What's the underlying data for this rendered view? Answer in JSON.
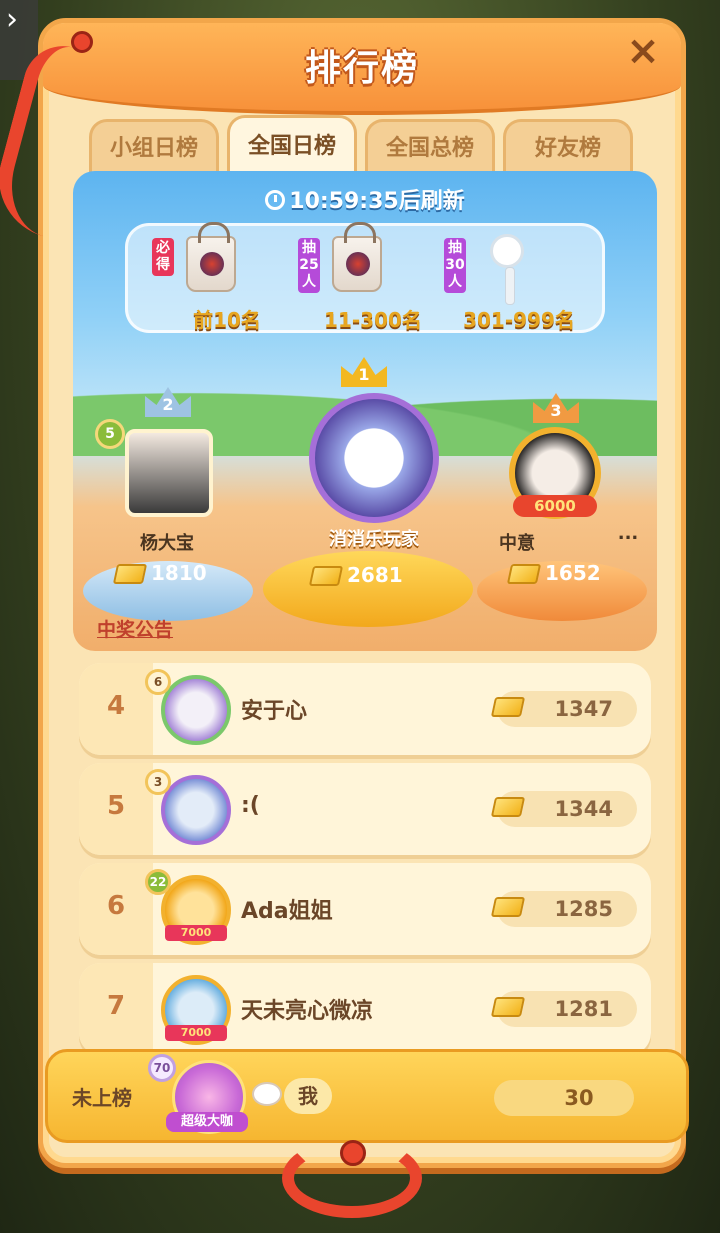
{
  "header": {
    "title": "排行榜",
    "close_icon": "×"
  },
  "back_icon": "›",
  "tabs": [
    {
      "label": "小组日榜",
      "active": false
    },
    {
      "label": "全国日榜",
      "active": true
    },
    {
      "label": "全国总榜",
      "active": false
    },
    {
      "label": "好友榜",
      "active": false
    }
  ],
  "refresh": {
    "time": "10:59:35",
    "suffix": "后刷新"
  },
  "prizes": [
    {
      "tag": "必得",
      "item": "bag-icon",
      "label": "前10名"
    },
    {
      "tag": "抽25人",
      "item": "bag-icon",
      "label": "11-300名"
    },
    {
      "tag": "抽30人",
      "item": "fan-icon",
      "label": "301-999名"
    }
  ],
  "podium": {
    "first": {
      "rank": "1",
      "name": "消消乐玩家",
      "score": "2681"
    },
    "second": {
      "rank": "2",
      "level": "5",
      "name": "杨大宝",
      "score": "1810"
    },
    "third": {
      "rank": "3",
      "badge": "6000",
      "name": "中意",
      "more": "...",
      "score": "1652"
    }
  },
  "notice": "中奖公告",
  "rows": [
    {
      "rank": "4",
      "level": "6",
      "name": "安于心",
      "score": "1347"
    },
    {
      "rank": "5",
      "level": "3",
      "name": ":(",
      "score": "1344"
    },
    {
      "rank": "6",
      "level": "22",
      "name": "Ada姐姐",
      "score": "1285",
      "badge": "7000"
    },
    {
      "rank": "7",
      "name": "天未亮心微凉",
      "score": "1281",
      "badge": "7000"
    }
  ],
  "me": {
    "label": "未上榜",
    "level": "70",
    "title": "超级大咖",
    "name": "我",
    "score": "30"
  },
  "colors": {
    "accent": "#f7913a",
    "gold": "#f3b821",
    "panel": "#fbe4b4"
  }
}
